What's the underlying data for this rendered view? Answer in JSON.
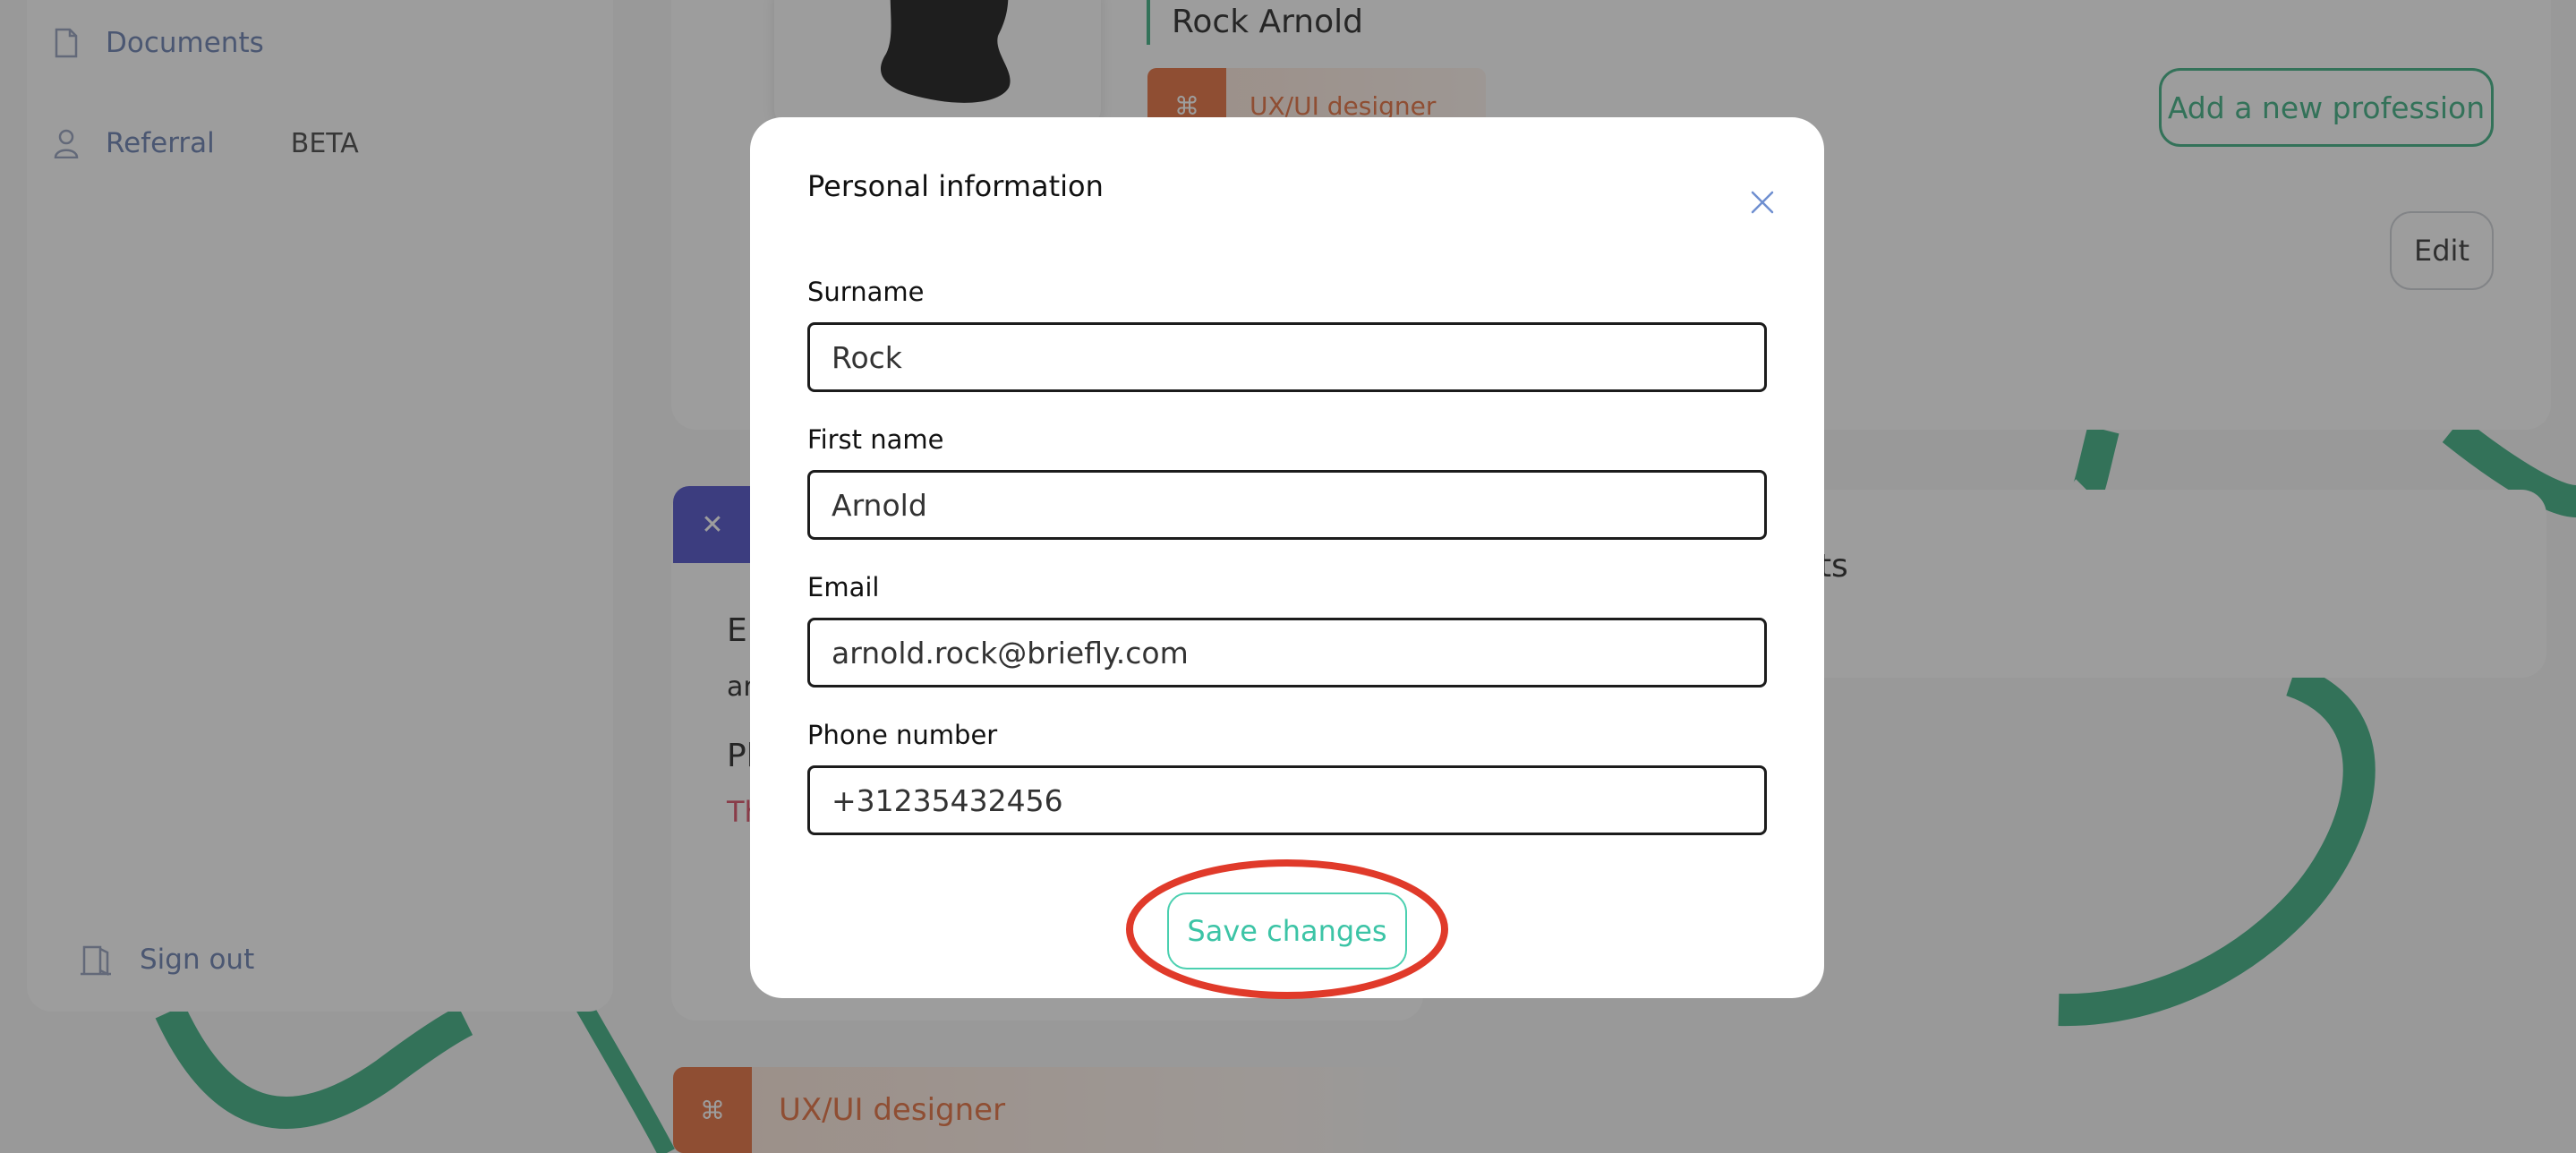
{
  "sidebar": {
    "items": [
      {
        "label": "Documents",
        "icon": "document-icon"
      },
      {
        "label": "Referral",
        "icon": "user-icon",
        "badge": "BETA"
      }
    ],
    "sign_out": {
      "label": "Sign out",
      "icon": "door-icon"
    }
  },
  "profile": {
    "name": "Rock Arnold",
    "profession_chip": "UX/UI designer",
    "add_profession_label": "Add a new profession",
    "edit_label": "Edit"
  },
  "background_cards": {
    "low_heading_1": "Er",
    "low_line_1": "ar",
    "low_heading_2": "Pl",
    "low_red": "Th",
    "mid_text": "ects",
    "bottom_chip": "UX/UI designer"
  },
  "modal": {
    "title": "Personal information",
    "fields": [
      {
        "label": "Surname",
        "value": "Rock"
      },
      {
        "label": "First name",
        "value": "Arnold"
      },
      {
        "label": "Email",
        "value": "arnold.rock@briefly.com"
      },
      {
        "label": "Phone number",
        "value": "+31235432456"
      }
    ],
    "save_label": "Save changes"
  },
  "colors": {
    "accent_green": "#2aa877",
    "save_teal": "#3cc4a6",
    "profession_orange": "#e2602a",
    "highlight_red": "#e03a2a",
    "tab_blue": "#3d3ec2"
  }
}
